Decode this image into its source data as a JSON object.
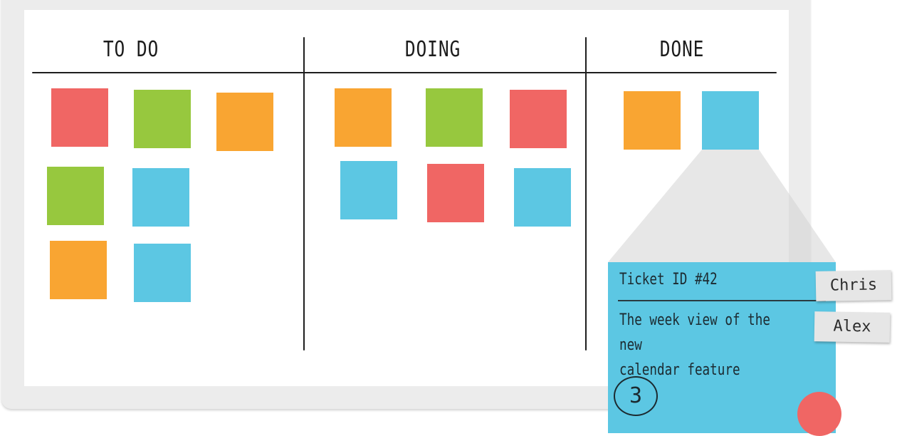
{
  "columns": [
    {
      "title": "TO DO"
    },
    {
      "title": "DOING"
    },
    {
      "title": "DONE"
    }
  ],
  "colors": {
    "red": "#f06664",
    "green": "#97c83e",
    "orange": "#f9a532",
    "blue": "#5cc7e3"
  },
  "notes": {
    "todo": [
      "red",
      "green",
      "orange",
      "green",
      "blue",
      "orange",
      "blue"
    ],
    "doing": [
      "orange",
      "green",
      "red",
      "blue",
      "red",
      "blue"
    ],
    "done": [
      "orange",
      "blue"
    ]
  },
  "ticket": {
    "id_label": "Ticket ID #42",
    "description_line1": "The week view of the new",
    "description_line2": "calendar feature",
    "points": "3",
    "assignees": [
      "Chris",
      "Alex"
    ]
  }
}
